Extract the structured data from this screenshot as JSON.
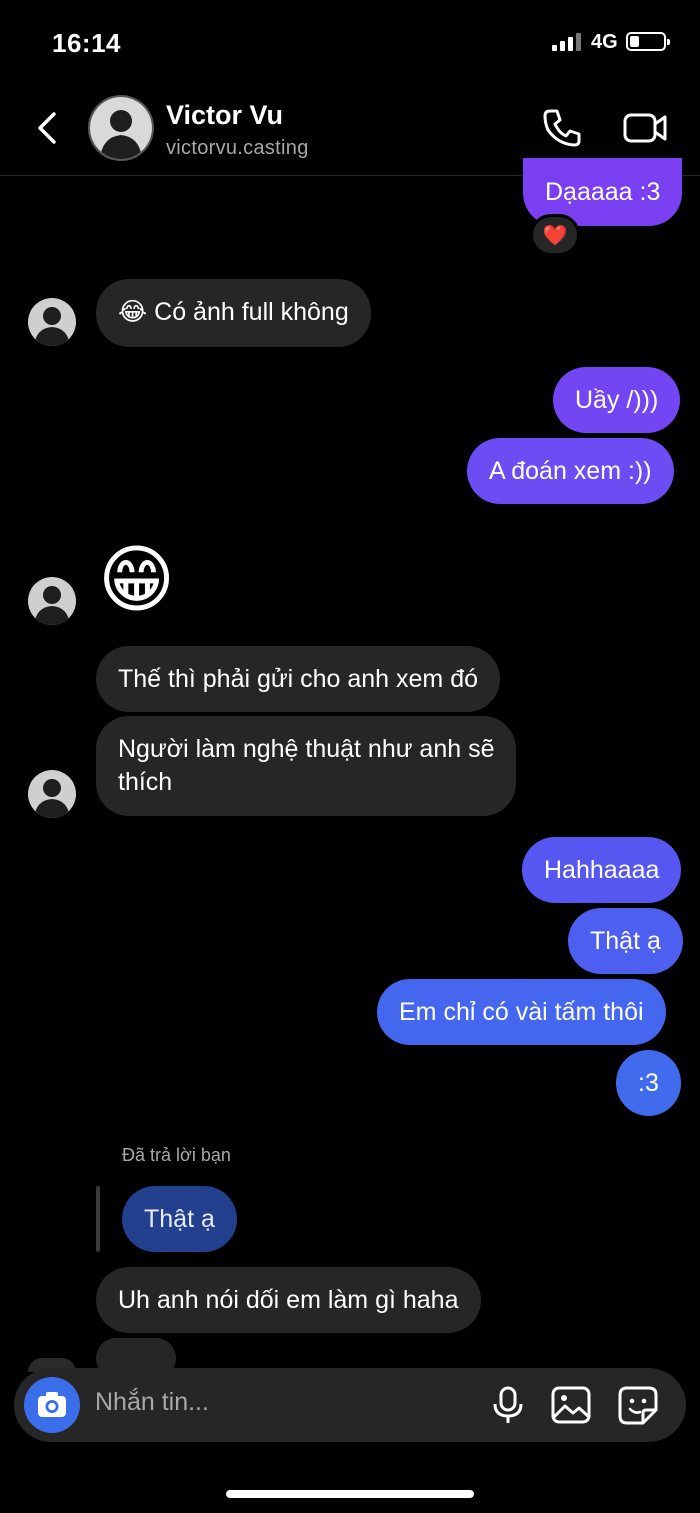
{
  "status_bar": {
    "time": "16:14",
    "network": "4G",
    "battery_level": 0.25
  },
  "header": {
    "name": "Victor Vu",
    "username": "victorvu.casting",
    "avatar_icon": "profile-photo-icon"
  },
  "messages": [
    {
      "side": "out",
      "text": "Dạaaaa :3"
    },
    {
      "side": "in",
      "text": "😂 Có ảnh full không"
    },
    {
      "side": "out",
      "text": "Uầy /)))"
    },
    {
      "side": "out",
      "text": "A đoán xem :))"
    },
    {
      "side": "in",
      "text": "😁"
    },
    {
      "side": "in",
      "text": "Thế thì phải gửi cho anh xem đó"
    },
    {
      "side": "in",
      "text": "Người làm nghệ thuật như anh sẽ\nthích"
    },
    {
      "side": "out",
      "text": "Hahhaaaa"
    },
    {
      "side": "out",
      "text": "Thật ạ"
    },
    {
      "side": "out",
      "text": "Em chỉ có vài tấm thôi"
    },
    {
      "side": "out",
      "text": ":3"
    },
    {
      "side": "in",
      "text": "Uh anh nói dối em làm gì haha"
    }
  ],
  "reaction": {
    "emoji": "❤️"
  },
  "reply": {
    "label": "Đã trả lời bạn",
    "quoted_text": "Thật ạ"
  },
  "composer": {
    "placeholder": "Nhắn tin..."
  },
  "colors": {
    "background": "#000000",
    "incoming_bubble": "#262626",
    "outgoing_top": "#7b3ff2",
    "outgoing_bottom": "#3b6eea",
    "accent": "#3b6eea"
  }
}
